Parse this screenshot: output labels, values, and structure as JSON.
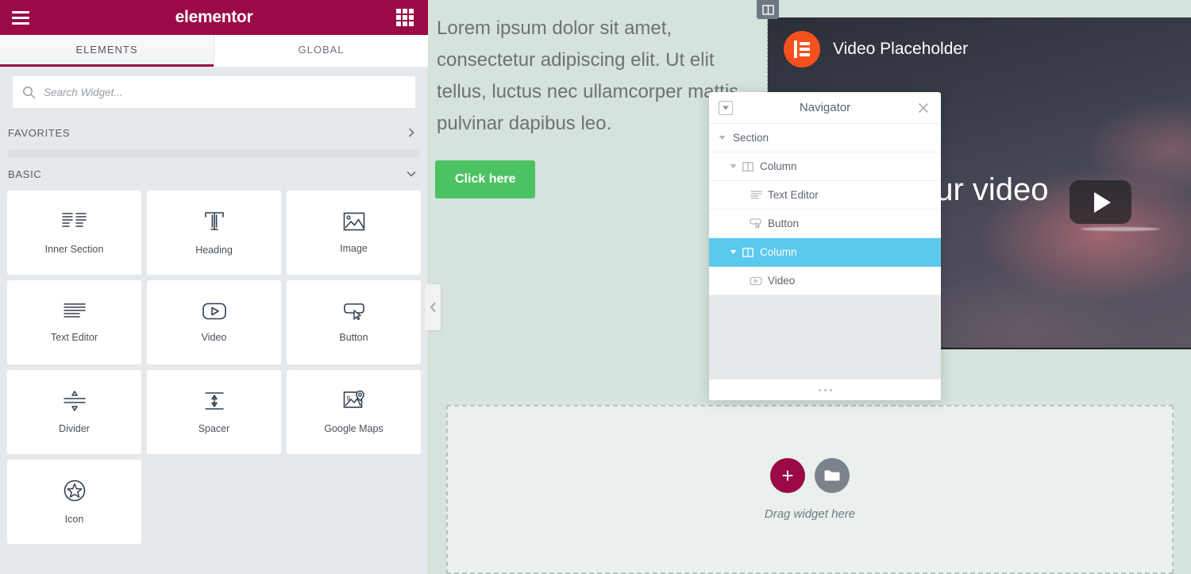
{
  "panel": {
    "logo": "elementor",
    "menu_icon": "hamburger-icon",
    "apps_icon": "apps-grid-icon",
    "tabs": [
      {
        "label": "ELEMENTS",
        "active": true
      },
      {
        "label": "GLOBAL",
        "active": false
      }
    ],
    "search": {
      "placeholder": "Search Widget...",
      "value": "",
      "icon": "search-icon"
    },
    "categories": [
      {
        "label": "FAVORITES",
        "state": "collapsed",
        "chevron": "chevron-right-icon"
      },
      {
        "label": "BASIC",
        "state": "expanded",
        "chevron": "chevron-down-icon"
      }
    ],
    "widgets": [
      {
        "label": "Inner Section",
        "icon": "inner-section-icon"
      },
      {
        "label": "Heading",
        "icon": "heading-icon"
      },
      {
        "label": "Image",
        "icon": "image-icon"
      },
      {
        "label": "Text Editor",
        "icon": "text-editor-icon"
      },
      {
        "label": "Video",
        "icon": "video-icon"
      },
      {
        "label": "Button",
        "icon": "button-icon"
      },
      {
        "label": "Divider",
        "icon": "divider-icon"
      },
      {
        "label": "Spacer",
        "icon": "spacer-icon"
      },
      {
        "label": "Google Maps",
        "icon": "google-maps-icon"
      },
      {
        "label": "Icon",
        "icon": "star-icon"
      }
    ],
    "collapse_handle_icon": "chevron-left-icon"
  },
  "canvas": {
    "text_widget": "Lorem ipsum dolor sit amet, consectetur adipiscing elit. Ut elit tellus, luctus nec ullamcorper mattis, pulvinar dapibus leo.",
    "button_label": "Click here",
    "column_handle_icon": "column-handle-icon",
    "video": {
      "badge_title": "Video Placeholder",
      "logo_icon": "elementor-logo-icon",
      "center_text": "Choose your video",
      "play_icon": "play-button-icon"
    },
    "drop_zone": {
      "add_section_icon": "plus-icon",
      "templates_icon": "folder-icon",
      "label": "Drag widget here"
    }
  },
  "navigator": {
    "title": "Navigator",
    "collapse_all_icon": "collapse-all-icon",
    "close_icon": "close-icon",
    "resize_icon": "resize-dots-icon",
    "items": [
      {
        "label": "Section",
        "icon": null,
        "indent": 0,
        "twist": "chevron-down-icon",
        "selected": false
      },
      {
        "label": "Column",
        "icon": "column-icon",
        "indent": 1,
        "twist": "chevron-down-icon",
        "selected": false
      },
      {
        "label": "Text Editor",
        "icon": "text-editor-icon",
        "indent": 2,
        "twist": null,
        "selected": false
      },
      {
        "label": "Button",
        "icon": "button-icon",
        "indent": 2,
        "twist": null,
        "selected": false
      },
      {
        "label": "Column",
        "icon": "column-icon",
        "indent": 1,
        "twist": "chevron-down-icon",
        "selected": true
      },
      {
        "label": "Video",
        "icon": "video-icon",
        "indent": 2,
        "twist": null,
        "selected": false
      }
    ]
  },
  "colors": {
    "brand": "#9b0a46",
    "accent_selected": "#5bc8ee",
    "button_green": "#4dc262",
    "elementor_orange": "#f4511e",
    "canvas_bg": "#d6e2dc",
    "panel_bg": "#e6e9ec"
  }
}
